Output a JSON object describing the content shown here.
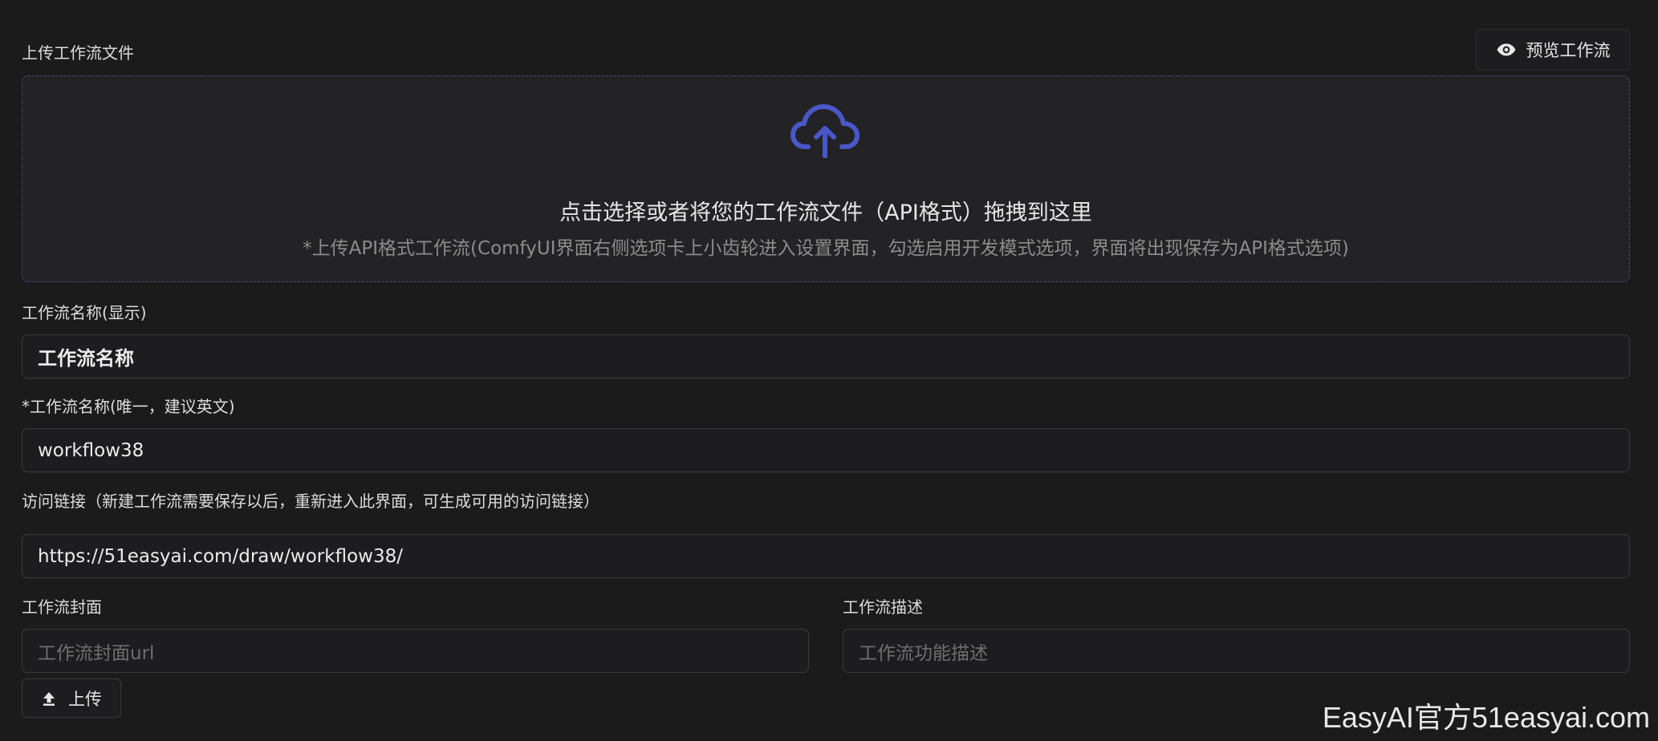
{
  "upload": {
    "label": "上传工作流文件",
    "preview_button": "预览工作流",
    "drop_title": "点击选择或者将您的工作流文件（API格式）拖拽到这里",
    "drop_hint": "*上传API格式工作流(ComfyUI界面右侧选项卡上小齿轮进入设置界面，勾选启用开发模式选项，界面将出现保存为API格式选项)"
  },
  "fields": {
    "display_name_label": "工作流名称(显示)",
    "display_name_value": "工作流名称",
    "unique_name_label": "*工作流名称(唯一，建议英文)",
    "unique_name_value": "workflow38",
    "access_link_label": "访问链接（新建工作流需要保存以后，重新进入此界面，可生成可用的访问链接）",
    "access_link_value": "https://51easyai.com/draw/workflow38/",
    "cover_label": "工作流封面",
    "cover_placeholder": "工作流封面url",
    "description_label": "工作流描述",
    "description_placeholder": "工作流功能描述",
    "upload_button": "上传"
  },
  "watermark": "EasyAI官方51easyai.com",
  "colors": {
    "background": "#1b1b1c",
    "accent": "#4a57c8",
    "dropzone_border": "#4a4a7a"
  }
}
